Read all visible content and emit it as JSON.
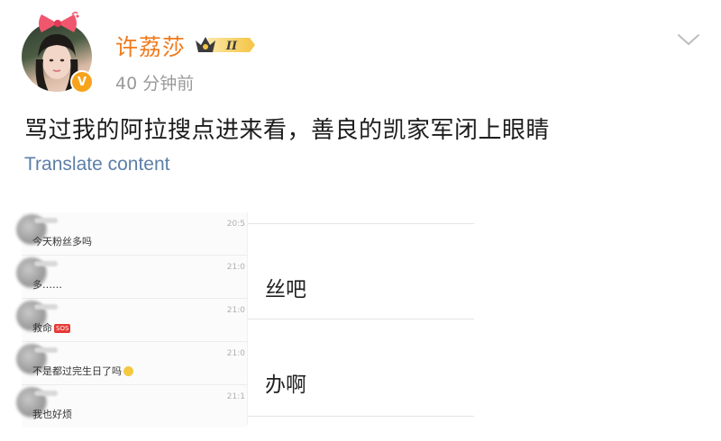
{
  "header": {
    "username": "许荔莎",
    "vip_level": "II",
    "time": "40 分钟前",
    "verify_mark": "V"
  },
  "post": {
    "text": "骂过我的阿拉搜点进来看，善良的凯家军闭上眼睛",
    "translate_label": "Translate content"
  },
  "image": {
    "chats": [
      {
        "time": "20:5",
        "message": "今天粉丝多吗",
        "badge": "",
        "emoji": false
      },
      {
        "time": "21:0",
        "message": "多……",
        "badge": "",
        "emoji": false
      },
      {
        "time": "21:0",
        "message": "救命",
        "badge": "SOS",
        "emoji": false
      },
      {
        "time": "21:0",
        "message": "不是都过完生日了吗",
        "badge": "",
        "emoji": true
      },
      {
        "time": "21:1",
        "message": "我也好烦",
        "badge": "",
        "emoji": false
      }
    ],
    "right_texts": [
      "丝吧",
      "办啊"
    ]
  },
  "colors": {
    "username": "#f07a1b",
    "link": "#5c7fa8",
    "time": "#9a9a9a",
    "verify_badge": "#f7a31b"
  },
  "icons": {
    "chevron": "chevron-down-icon",
    "verify": "verified-icon",
    "vip": "crown-vip-icon"
  }
}
